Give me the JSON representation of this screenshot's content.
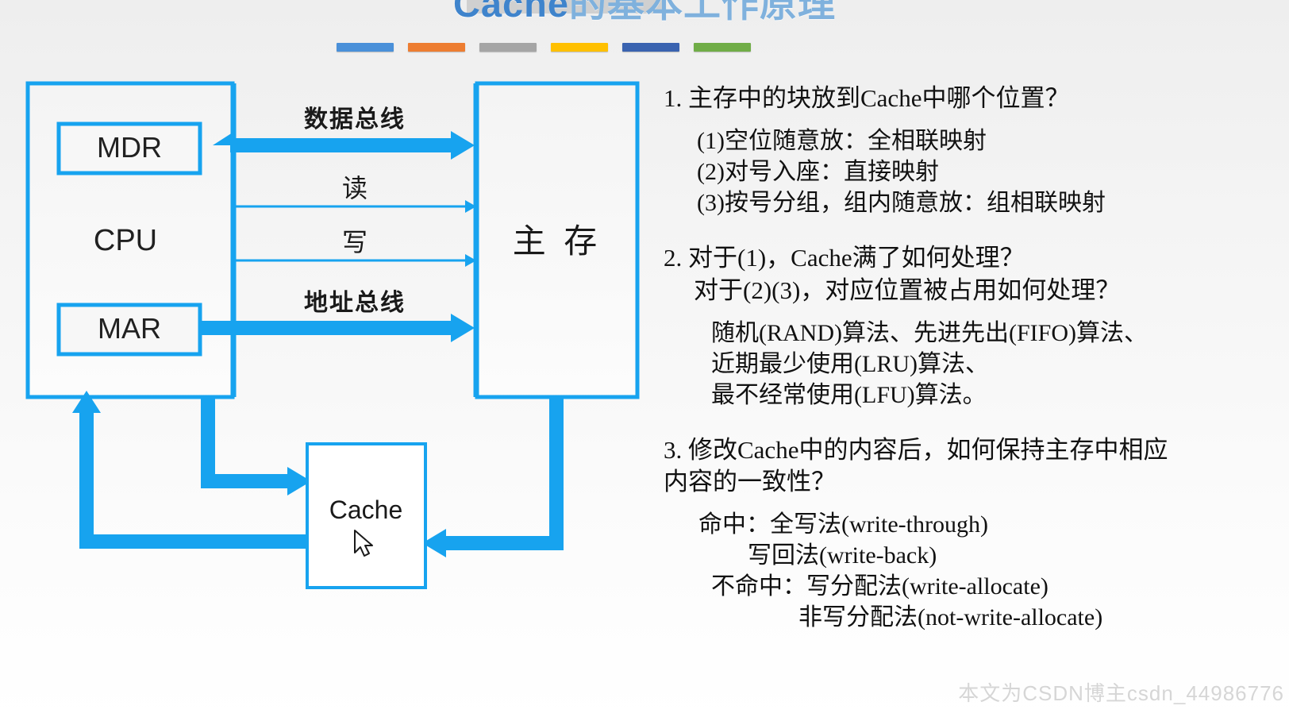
{
  "slide": {
    "title_en": "Cache",
    "title_cn": "的基本工作原理",
    "watermark": "本文为CSDN博主csdn_44986776"
  },
  "colors": {
    "accent_blue": "#17a3ef",
    "title_blue": "#5b9bd5",
    "bar1": "#4a90d9",
    "bar2": "#ed7d31",
    "bar3": "#a5a5a5",
    "bar4": "#ffc000",
    "bar5": "#3a63b0",
    "bar6": "#70ad47"
  },
  "diagram": {
    "cpu_label": "CPU",
    "mdr_label": "MDR",
    "mar_label": "MAR",
    "memory_label": "主 存",
    "cache_label": "Cache",
    "data_bus_label": "数据总线",
    "read_label": "读",
    "write_label": "写",
    "address_bus_label": "地址总线",
    "cursor": "mouse-pointer"
  },
  "notes": [
    {
      "id": "q1",
      "heading": "1. 主存中的块放到Cache中哪个位置？",
      "lines": [
        "(1)空位随意放：全相联映射",
        "(2)对号入座：直接映射",
        "(3)按号分组，组内随意放：组相联映射"
      ]
    },
    {
      "id": "q2",
      "heading": "2. 对于(1)，Cache满了如何处理？",
      "heading2": "对于(2)(3)，对应位置被占用如何处理？",
      "lines": [
        "随机(RAND)算法、先进先出(FIFO)算法、",
        "近期最少使用(LRU)算法、",
        "最不经常使用(LFU)算法。"
      ]
    },
    {
      "id": "q3",
      "heading": "3. 修改Cache中的内容后，如何保持主存中相应",
      "heading2": "内容的一致性？",
      "lines": [
        "命中：全写法(write-through)",
        "写回法(write-back)",
        "不命中：写分配法(write-allocate)",
        "非写分配法(not-write-allocate)"
      ]
    }
  ]
}
